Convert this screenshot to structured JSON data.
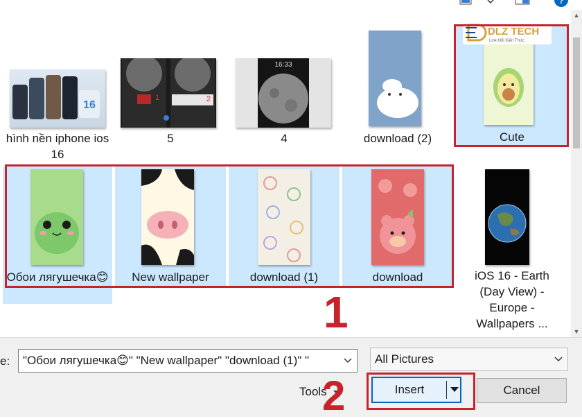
{
  "files": [
    {
      "name": "hình nền iphone ios 16"
    },
    {
      "name": "5",
      "markers": [
        "1",
        "2"
      ]
    },
    {
      "name": "4",
      "lock_time": "16:33"
    },
    {
      "name": "download (2)"
    },
    {
      "name": "Cute"
    },
    {
      "name": "Обои лягушечка😊"
    },
    {
      "name": "New wallpaper"
    },
    {
      "name": "download (1)"
    },
    {
      "name": "download"
    },
    {
      "name": "iOS 16 - Earth (Day View) - Europe - Wallpapers ..."
    }
  ],
  "thumb_texts": {
    "ios16_badge": "16"
  },
  "watermark": {
    "brand": "DLZ TECH",
    "tagline": "Link Nổi Kiến Thức"
  },
  "annotations": {
    "step1": "1",
    "step2": "2"
  },
  "bottom": {
    "filename_label": "e:",
    "filename_value": "\"Обои лягушечка😊\" \"New wallpaper\" \"download (1)\" \"",
    "filter_value": "All Pictures",
    "tools_label": "Tools",
    "insert_label": "Insert",
    "cancel_label": "Cancel"
  },
  "colors": {
    "selection": "#cce8ff",
    "annotation_red": "#c8232c",
    "accent_blue": "#0067c0"
  },
  "icons": [
    "view-icon",
    "chevron-down-icon",
    "preview-pane-icon",
    "help-icon",
    "split-arrow-icon",
    "scroll-up-icon",
    "scroll-down-icon"
  ]
}
